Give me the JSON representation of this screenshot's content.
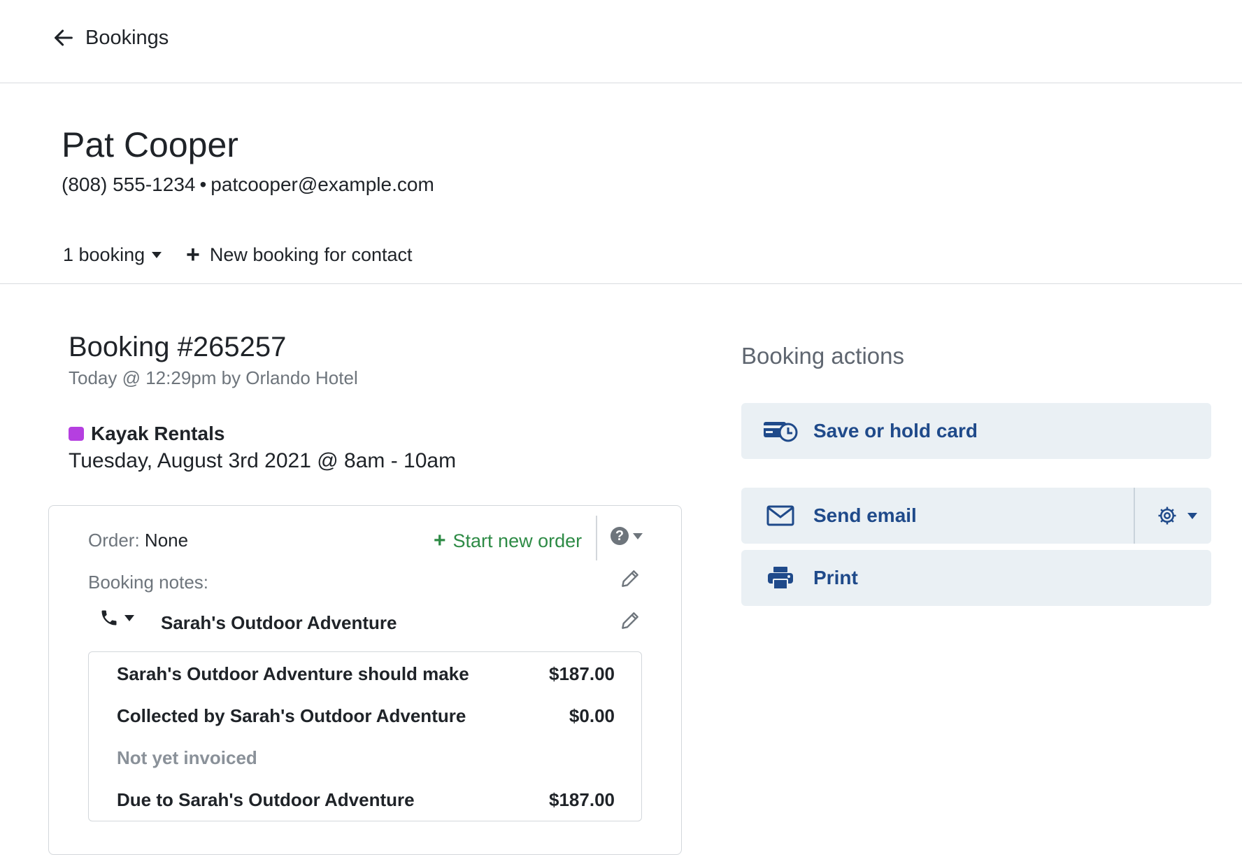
{
  "nav": {
    "back_label": "Bookings"
  },
  "contact": {
    "name": "Pat Cooper",
    "phone": "(808) 555-1234",
    "separator": "•",
    "email": "patcooper@example.com",
    "bookings_count_label": "1 booking",
    "new_booking_label": "New booking for contact"
  },
  "booking": {
    "title": "Booking #265257",
    "subtitle": "Today @ 12:29pm by Orlando Hotel",
    "activity_name": "Kayak Rentals",
    "activity_color": "#b53fe0",
    "date_time": "Tuesday, August 3rd 2021 @ 8am - 10am"
  },
  "order": {
    "label": "Order:",
    "value": "None",
    "start_new_label": "Start new order",
    "notes_label": "Booking notes:",
    "provider_name": "Sarah's Outdoor Adventure"
  },
  "summary": {
    "rows": [
      {
        "label": "Sarah's Outdoor Adventure should make",
        "value": "$187.00"
      },
      {
        "label": "Collected by Sarah's Outdoor Adventure",
        "value": "$0.00"
      },
      {
        "label": "Not yet invoiced",
        "value": ""
      },
      {
        "label": "Due to Sarah's Outdoor Adventure",
        "value": "$187.00"
      }
    ]
  },
  "actions": {
    "title": "Booking actions",
    "items": [
      {
        "label": "Save or hold card",
        "icon": "card-clock-icon"
      },
      {
        "label": "Send email",
        "icon": "envelope-icon"
      },
      {
        "label": "Print",
        "icon": "printer-icon"
      }
    ],
    "accent": "#1f4a8a",
    "background": "#eaf0f4"
  }
}
